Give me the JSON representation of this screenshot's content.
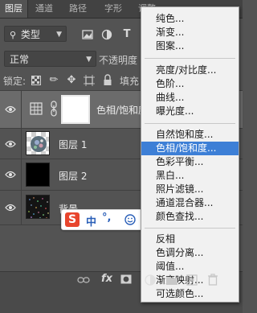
{
  "tabs": [
    "图层",
    "通道",
    "路径",
    "字形",
    "调整"
  ],
  "filter": {
    "label": "类型"
  },
  "blend": {
    "mode": "正常",
    "opacity_label": "不透明度"
  },
  "lock": {
    "label": "锁定:",
    "fill_label": "填充"
  },
  "layers": [
    {
      "name": "色相/饱和度..."
    },
    {
      "name": "图层 1"
    },
    {
      "name": "图层 2"
    },
    {
      "name": "背景"
    }
  ],
  "bottom": {
    "fx": "fx"
  },
  "menu": {
    "items": [
      "纯色...",
      "渐变...",
      "图案...",
      "亮度/对比度...",
      "色阶...",
      "曲线...",
      "曝光度...",
      "自然饱和度...",
      "色相/饱和度...",
      "色彩平衡...",
      "黑白...",
      "照片滤镜...",
      "通道混合器...",
      "颜色查找...",
      "反相",
      "色调分离...",
      "阈值...",
      "渐变映射...",
      "可选颜色..."
    ],
    "highlighted": "色相/饱和度..."
  },
  "ime": {
    "mode": "中",
    "punct": "°,"
  },
  "colors": {
    "menu_highlight": "#3d7fd6",
    "panel_bg": "#535353",
    "selected_layer": "#6b6b6b"
  }
}
